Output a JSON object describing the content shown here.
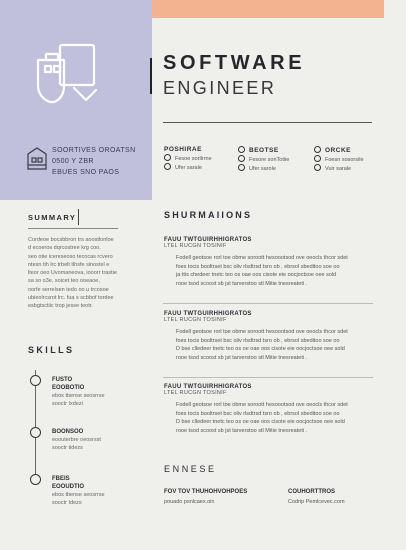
{
  "colors": {
    "accent": "#f3b290",
    "sidebar": "#c0c0dc",
    "background": "#efefec",
    "text": "#2e2e33"
  },
  "header": {
    "title_line1": "SOFTWARE",
    "title_line2": "ENGINEER",
    "logo_icon": "document-scroll-icon"
  },
  "contact": {
    "icon": "building-icon",
    "lines": [
      "SOORTIVES OROATSN",
      "0500 Y ZBR",
      "EBUES SNO PAOS"
    ]
  },
  "options": [
    {
      "heading": "POSHIRAE",
      "items": [
        "Fesoe sorllrrne",
        "Ufer sarale"
      ]
    },
    {
      "heading": "BEOTSE",
      "items": [
        "Fesore sonTotiie",
        "Ufer sarole"
      ]
    },
    {
      "heading": "ORCKE",
      "items": [
        "Foesn sosorsile",
        "Vuir sarale"
      ]
    }
  ],
  "summary": {
    "title": "SUMMARY",
    "lines": [
      "Cordeoe bocsbbron trs aoostlonloe",
      "d ecoeros dqrcostree krg coo.",
      "seo otie icereseoso tecocas rcvero",
      "ntesn tih lrc trbelt tlhsfe sinostel e",
      "lteor oeo Uvomaneova, iooorr trastie",
      "sa so o3e, soicet teo ooeaoe,",
      "oorfe serrelsen tedo oo u trcosoe",
      "ubieolrcsrot lrc. fua s scbbof tordee",
      "esbgtsctiic trop jesse teotr."
    ]
  },
  "skills": {
    "title": "SKILLS",
    "items": [
      {
        "name": "FUSTO",
        "sub": [
          "EOOBOTIO",
          "ebos tbense seosrrse",
          "sooctr Ixdezi"
        ]
      },
      {
        "name": "BOONSOO",
        "sub": [
          "eoouterbre oeosrsst",
          "sooctr tidezs"
        ]
      },
      {
        "name": "FBEIS",
        "sub": [
          "EOOUDTIO",
          "ebos tbense seosrrse",
          "sooctr Idezs"
        ]
      }
    ]
  },
  "experience": {
    "title": "SHURMAIIONS",
    "jobs": [
      {
        "title": "FAUU TWTGUIRHHIGRATOS",
        "company": "LTEL  RUCGN TOSINIF",
        "bullets": [
          "Fodell geotsoe rorl toe obme soroott hesoootsod ove oeocls thcor sdet",
          "foes tocis booltrset bsc oliv rlsdtrsd tsro ob , ebrsol sbeditoo soe oo",
          "ja ttis chedeer tnetc teo os oae oos cisote eie oocjoctsoe oee sold",
          "rooe tsod scoost  sb jst tarverstoo stl Mitie tnesreateti ."
        ]
      },
      {
        "title": "FAUU TWTGUIRHHIGRATOS",
        "company": "LTEL  RUCGN TOSINIF",
        "bullets": [
          "Fodell geotsoe rorl toe obme soroott hesoootsod ove oeocls thcor sdet",
          "foes tocis booltrset bsc oliv rlsdtrsd tsro ob , ebrsol sbeditoo soe oo",
          "D bse clledeer tnetc teo os oe oae oos cisote eie oocjoctsoe oee sold",
          "rooe tsod scoost  sb jst tarverstoo stl Mitie tnesreateti ."
        ]
      },
      {
        "title": "FAUU TWTGUIRHHIGRATOS",
        "company": "LTEL  RUCGN TOSINIF",
        "bullets": [
          "Fodell geotsoe rorl toe obme soroott hesoootsod ove oeocls thcor sdet",
          "foes tocis booltrset bsc oliv rlsdtrsd tsro ob , ebrsol sbeditoo soe oo",
          "D bse clledeer tnetc teo os oe oae oos cisote eie oocjoctsoe oee sold",
          "rooe tsod scoost  sb jst tarverstoo stl Mitie tnesreateti ."
        ]
      }
    ]
  },
  "education": {
    "title": "ENNESE",
    "left": {
      "name": "FOV TOV THUHOHVOHPOES",
      "sub": "pouado psnlcaex.oin"
    },
    "right": {
      "name": "COUHORTTROS",
      "sub": "Codrip Pemlcevec.com"
    }
  }
}
